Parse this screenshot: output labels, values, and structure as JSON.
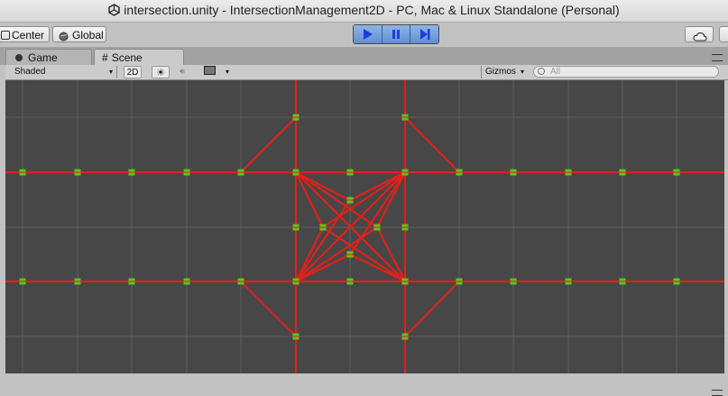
{
  "window": {
    "title": "intersection.unity - IntersectionManagement2D - PC, Mac & Linux Standalone (Personal)"
  },
  "toolbar": {
    "pivot_label": "Center",
    "space_label": "Global"
  },
  "tabs": {
    "game_label": "Game",
    "scene_label": "Scene"
  },
  "scene_toolbar": {
    "shading_value": "Shaded",
    "mode_2d_label": "2D",
    "gizmos_label": "Gizmos",
    "search_placeholder": "All"
  },
  "colors": {
    "road_line": "#e0201b",
    "waypoint": "#5fc41e",
    "scene_bg": "#474747",
    "grid": "#5c5c5c",
    "play_active": "#5f8fd2"
  },
  "icons": [
    "unity-logo-icon",
    "pivot-icon",
    "global-icon",
    "play-icon",
    "pause-icon",
    "step-icon",
    "cloud-icon",
    "layers-icon",
    "game-icon",
    "scene-icon",
    "light-icon",
    "audio-icon",
    "image-effects-icon",
    "dropdown-icon",
    "search-icon"
  ]
}
